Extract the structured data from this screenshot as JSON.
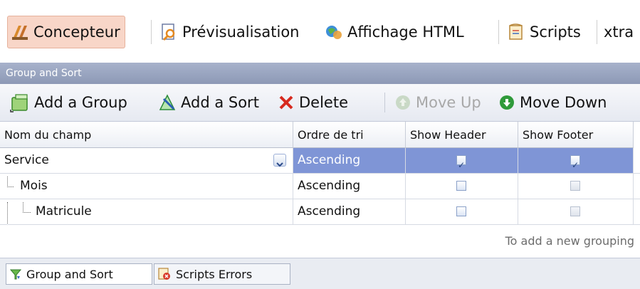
{
  "top_tabs": [
    {
      "label": "Concepteur",
      "icon": "designer-icon",
      "active": true
    },
    {
      "label": "Prévisualisation",
      "icon": "preview-icon"
    },
    {
      "label": "Affichage HTML",
      "icon": "html-view-icon"
    },
    {
      "label": "Scripts",
      "icon": "scripts-icon"
    },
    {
      "label": "xtra",
      "icon": ""
    }
  ],
  "panel": {
    "title": "Group and Sort"
  },
  "toolbar": {
    "add_group": "Add a Group",
    "add_sort": "Add a Sort",
    "delete": "Delete",
    "move_up": "Move Up",
    "move_down": "Move Down"
  },
  "grid": {
    "columns": [
      "Nom du champ",
      "Ordre de tri",
      "Show Header",
      "Show Footer"
    ],
    "rows": [
      {
        "field": "Service",
        "order": "Ascending",
        "show_header": true,
        "show_footer": true,
        "selected": true
      },
      {
        "field": "Mois",
        "order": "Ascending",
        "show_header": false,
        "show_footer": false
      },
      {
        "field": "Matricule",
        "order": "Ascending",
        "show_header": false,
        "show_footer": false
      }
    ],
    "hint": "To add a new grouping"
  },
  "bottom_tabs": [
    {
      "label": "Group and Sort",
      "icon": "group-sort-icon"
    },
    {
      "label": "Scripts Errors",
      "icon": "scripts-errors-icon"
    }
  ],
  "colors": {
    "selection": "#7f95d6",
    "panel_header": "#98a3bf",
    "active_tab": "#f8d6c8"
  }
}
